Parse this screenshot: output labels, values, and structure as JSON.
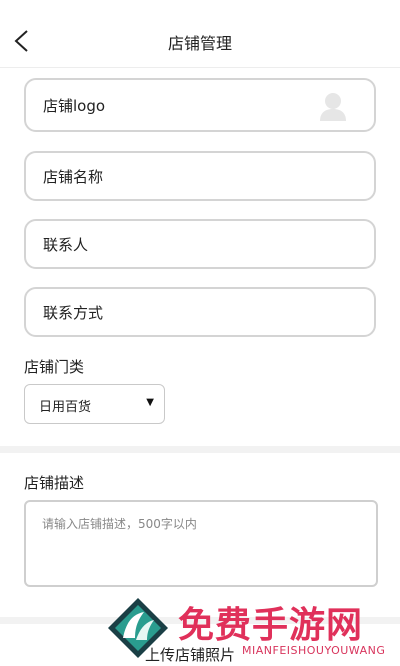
{
  "header": {
    "title": "店铺管理",
    "back_icon": "chevron-left-icon"
  },
  "form": {
    "logo_label": "店铺logo",
    "logo_placeholder_icon": "user-silhouette-icon",
    "name_label": "店铺名称",
    "contact_label": "联系人",
    "phone_label": "联系方式",
    "category_label": "店铺门类",
    "category_selected": "日用百货",
    "description_label": "店铺描述",
    "description_placeholder": "请输入店铺描述，500字以内",
    "upload_label": "上传店铺照片"
  },
  "watermark": {
    "title": "免费手游网",
    "subtitle": "MIANFEISHOUYOUWANG"
  }
}
